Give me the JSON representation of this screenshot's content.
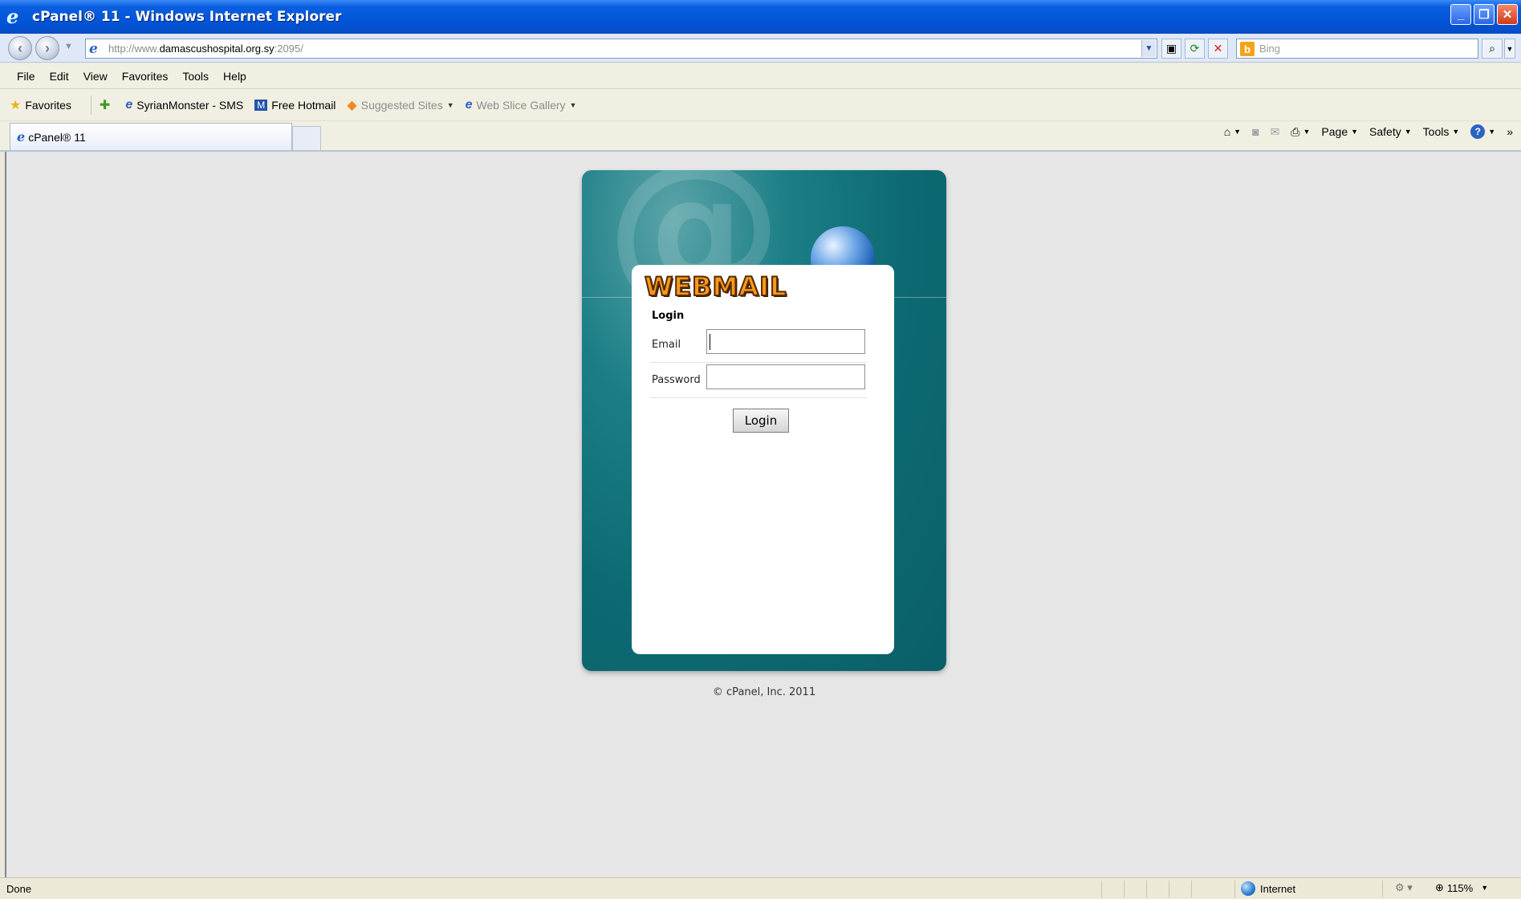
{
  "window": {
    "title": "cPanel® 11 - Windows Internet Explorer",
    "controls": [
      "minimize",
      "restore",
      "close"
    ]
  },
  "address_bar": {
    "url_prefix": "http://www.",
    "url_host": "damascushospital.org.sy",
    "url_suffix": ":2095/",
    "search_placeholder": "Bing"
  },
  "menu": {
    "items": [
      "File",
      "Edit",
      "View",
      "Favorites",
      "Tools",
      "Help"
    ]
  },
  "favorites_bar": {
    "favorites_label": "Favorites",
    "items": [
      "SyrianMonster - SMS",
      "Free Hotmail",
      "Suggested Sites",
      "Web Slice Gallery"
    ]
  },
  "tab": {
    "label": "cPanel® 11"
  },
  "command_bar": {
    "page": "Page",
    "safety": "Safety",
    "tools": "Tools"
  },
  "login": {
    "brand": "WEBMAIL",
    "title": "Login",
    "email_label": "Email",
    "email_value": "",
    "password_label": "Password",
    "password_value": "",
    "button": "Login"
  },
  "footer": {
    "copyright": "© cPanel, Inc. 2011"
  },
  "status_bar": {
    "status": "Done",
    "zone": "Internet",
    "zoom": "115%"
  },
  "colors": {
    "panel_teal": "#0d6a72",
    "brand_orange": "#f59a1b",
    "titlebar_blue": "#0053d6"
  }
}
